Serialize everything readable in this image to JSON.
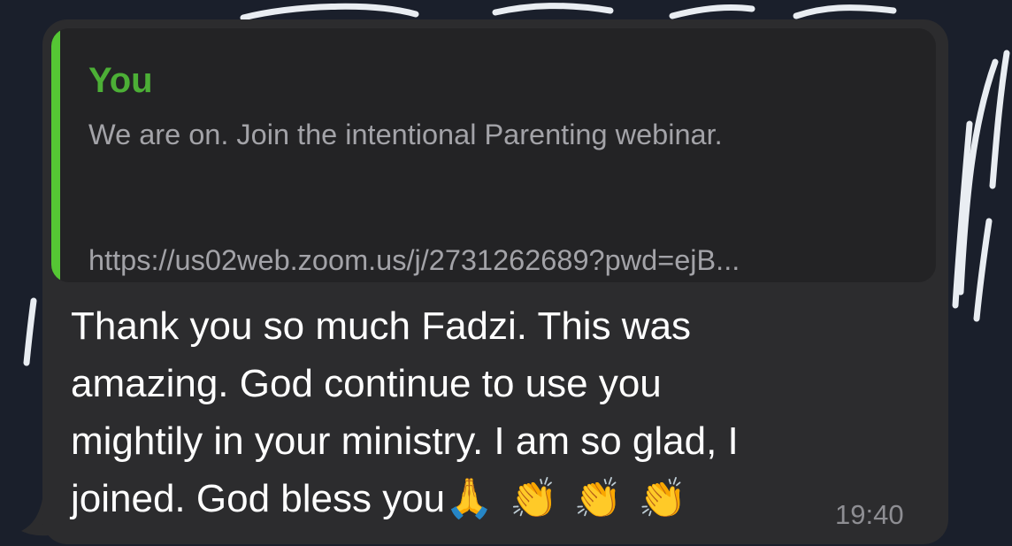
{
  "quoted_message": {
    "author": "You",
    "text": "We are on. Join the intentional Parenting webinar.",
    "link": "https://us02web.zoom.us/j/2731262689?pwd=ejB..."
  },
  "message": {
    "text_line1": "Thank you so much Fadzi. This was",
    "text_line2": "amazing. God continue to use you",
    "text_line3": "mightily in your ministry. I am so glad, I",
    "text_line4": "joined. God bless you",
    "emojis": {
      "pray": "🙏",
      "clap": "👏"
    },
    "time": "19:40"
  },
  "colors": {
    "background": "#1a1f2b",
    "bubble": "#2c2c2e",
    "quote_background": "#232325",
    "quote_accent": "#55c634",
    "author_name": "#4caf36",
    "quote_text": "#a3a3a8",
    "message_text": "#ffffff",
    "timestamp": "#8e8e93"
  }
}
